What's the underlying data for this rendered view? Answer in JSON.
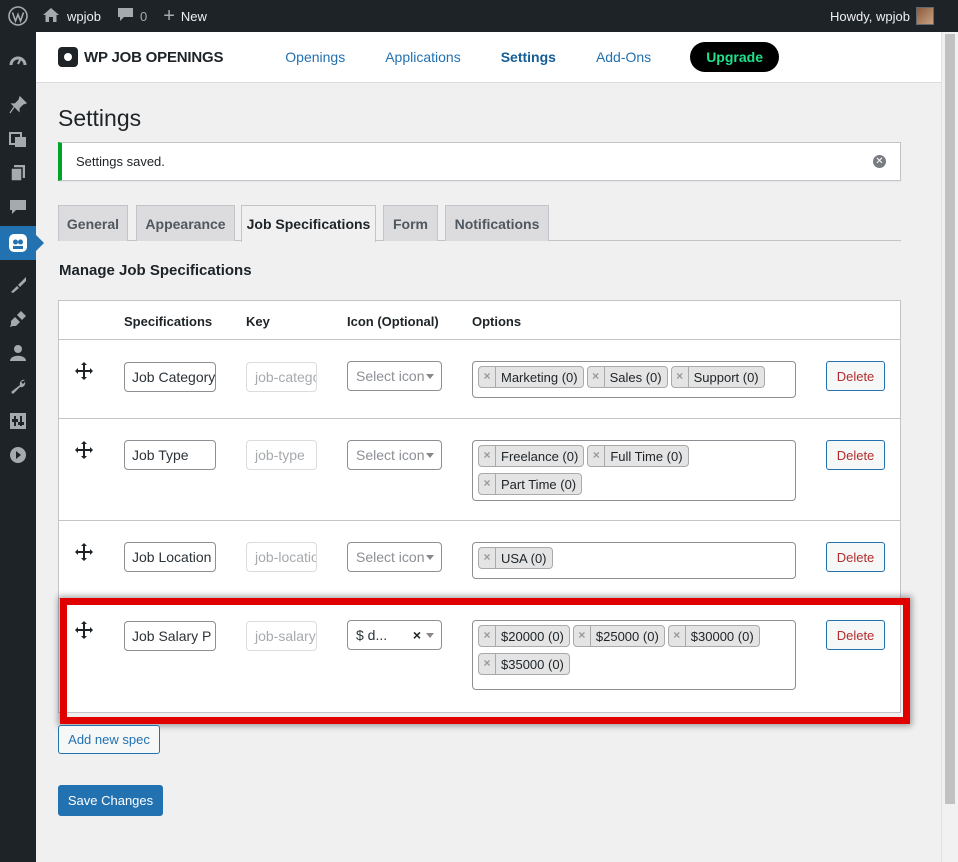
{
  "admin_bar": {
    "site_name": "wpjob",
    "comments_count": "0",
    "new_label": "New",
    "howdy": "Howdy, wpjob"
  },
  "plugin_header": {
    "brand": "WP JOB OPENINGS",
    "nav": [
      "Openings",
      "Applications",
      "Settings",
      "Add-Ons"
    ],
    "active_nav": "Settings",
    "upgrade_label": "Upgrade"
  },
  "page": {
    "title": "Settings",
    "notice": "Settings saved.",
    "section_title": "Manage Job Specifications"
  },
  "tabs": [
    "General",
    "Appearance",
    "Job Specifications",
    "Form",
    "Notifications"
  ],
  "active_tab": "Job Specifications",
  "table": {
    "headers": [
      "Specifications",
      "Key",
      "Icon (Optional)",
      "Options"
    ],
    "delete_label": "Delete",
    "rows": [
      {
        "spec": "Job Category",
        "key_placeholder": "job-category",
        "icon": "Select icon",
        "options": [
          "Marketing (0)",
          "Sales (0)",
          "Support (0)"
        ]
      },
      {
        "spec": "Job Type",
        "key_placeholder": "job-type",
        "icon": "Select icon",
        "options": [
          "Freelance (0)",
          "Full Time (0)",
          "Part Time (0)"
        ]
      },
      {
        "spec": "Job Location",
        "key_placeholder": "job-location",
        "icon": "Select icon",
        "options": [
          "USA (0)"
        ]
      },
      {
        "spec": "Job Salary P",
        "key_placeholder": "job-salary",
        "icon": "$ d...",
        "options": [
          "$20000 (0)",
          "$25000 (0)",
          "$30000 (0)",
          "$35000 (0)"
        ]
      }
    ]
  },
  "buttons": {
    "add_new_spec": "Add new spec",
    "save_changes": "Save Changes"
  },
  "colors": {
    "admin_dark": "#1d2327",
    "accent_blue": "#2271b1",
    "success_green": "#00a32a",
    "upgrade_green": "#1ee28a",
    "highlight_red": "#e00000"
  }
}
